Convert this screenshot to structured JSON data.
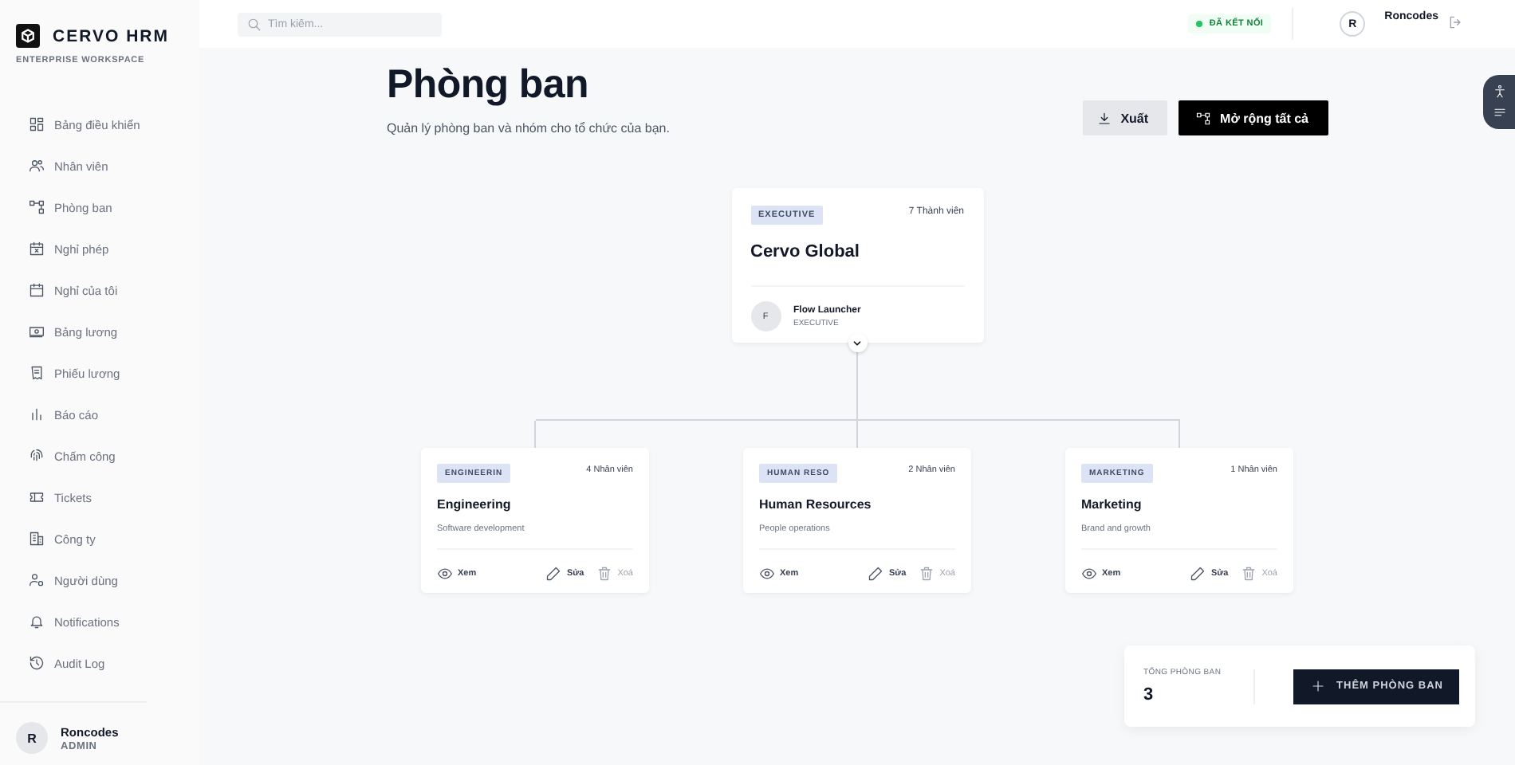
{
  "sidebar": {
    "brand": "CERVO HRM",
    "tagline": "ENTERPRISE WORKSPACE",
    "items": [
      {
        "label": "Bảng điều khiển",
        "selected": false
      },
      {
        "label": "Nhân viên",
        "selected": false
      },
      {
        "label": "Phòng ban",
        "selected": false
      },
      {
        "label": "Nghỉ phép",
        "selected": false
      },
      {
        "label": "Nghỉ của tôi",
        "selected": false
      },
      {
        "label": "Bảng lương",
        "selected": false
      },
      {
        "label": "Phiếu lương",
        "selected": false
      },
      {
        "label": "Báo cáo",
        "selected": false
      },
      {
        "label": "Chấm công",
        "selected": false
      },
      {
        "label": "Tickets",
        "selected": false
      },
      {
        "label": "Công ty",
        "selected": false
      },
      {
        "label": "Người dùng",
        "selected": false
      },
      {
        "label": "Notifications",
        "selected": false
      },
      {
        "label": "Audit Log",
        "selected": false
      }
    ],
    "user": {
      "avatar": "R",
      "name": "Roncodes",
      "role": "ADMIN"
    }
  },
  "topbar": {
    "search": {
      "placeholder": "Tìm kiếm..."
    },
    "status": "ĐÃ KẾT NỐI",
    "user": {
      "avatar": "R",
      "name": "Roncodes"
    }
  },
  "page": {
    "title": "Phòng ban",
    "subtitle": "Quản lý phòng ban và nhóm cho tổ chức của bạn.",
    "buttons": [
      {
        "label": "Xuất",
        "kind": "secondary"
      },
      {
        "label": "Mở rộng tất cả",
        "kind": "primary"
      }
    ]
  },
  "root": {
    "tag": "EXECUTIVE",
    "members": "7 Thành viên",
    "name": "Cervo Global",
    "head": {
      "avatar": "F",
      "name": "Flow Launcher",
      "role": "EXECUTIVE"
    }
  },
  "departments": [
    {
      "tag": "ENGINEERIN",
      "members": "4 Nhân viên",
      "name": "Engineering",
      "description": "Software development",
      "actions": [
        {
          "label": "Xem",
          "disabled": false
        },
        {
          "label": "Sửa",
          "disabled": false
        },
        {
          "label": "Xoá",
          "disabled": true
        }
      ]
    },
    {
      "tag": "HUMAN RESO",
      "members": "2 Nhân viên",
      "name": "Human Resources",
      "description": "People operations",
      "actions": [
        {
          "label": "Xem",
          "disabled": false
        },
        {
          "label": "Sửa",
          "disabled": false
        },
        {
          "label": "Xoá",
          "disabled": true
        }
      ]
    },
    {
      "tag": "MARKETING",
      "members": "1 Nhân viên",
      "name": "Marketing",
      "description": "Brand and growth",
      "actions": [
        {
          "label": "Xem",
          "disabled": false
        },
        {
          "label": "Sửa",
          "disabled": false
        },
        {
          "label": "Xoá",
          "disabled": true
        }
      ]
    }
  ],
  "summary": {
    "label": "TỔNG PHÒNG BAN",
    "value": "3",
    "button": "THÊM PHÒNG BAN"
  }
}
